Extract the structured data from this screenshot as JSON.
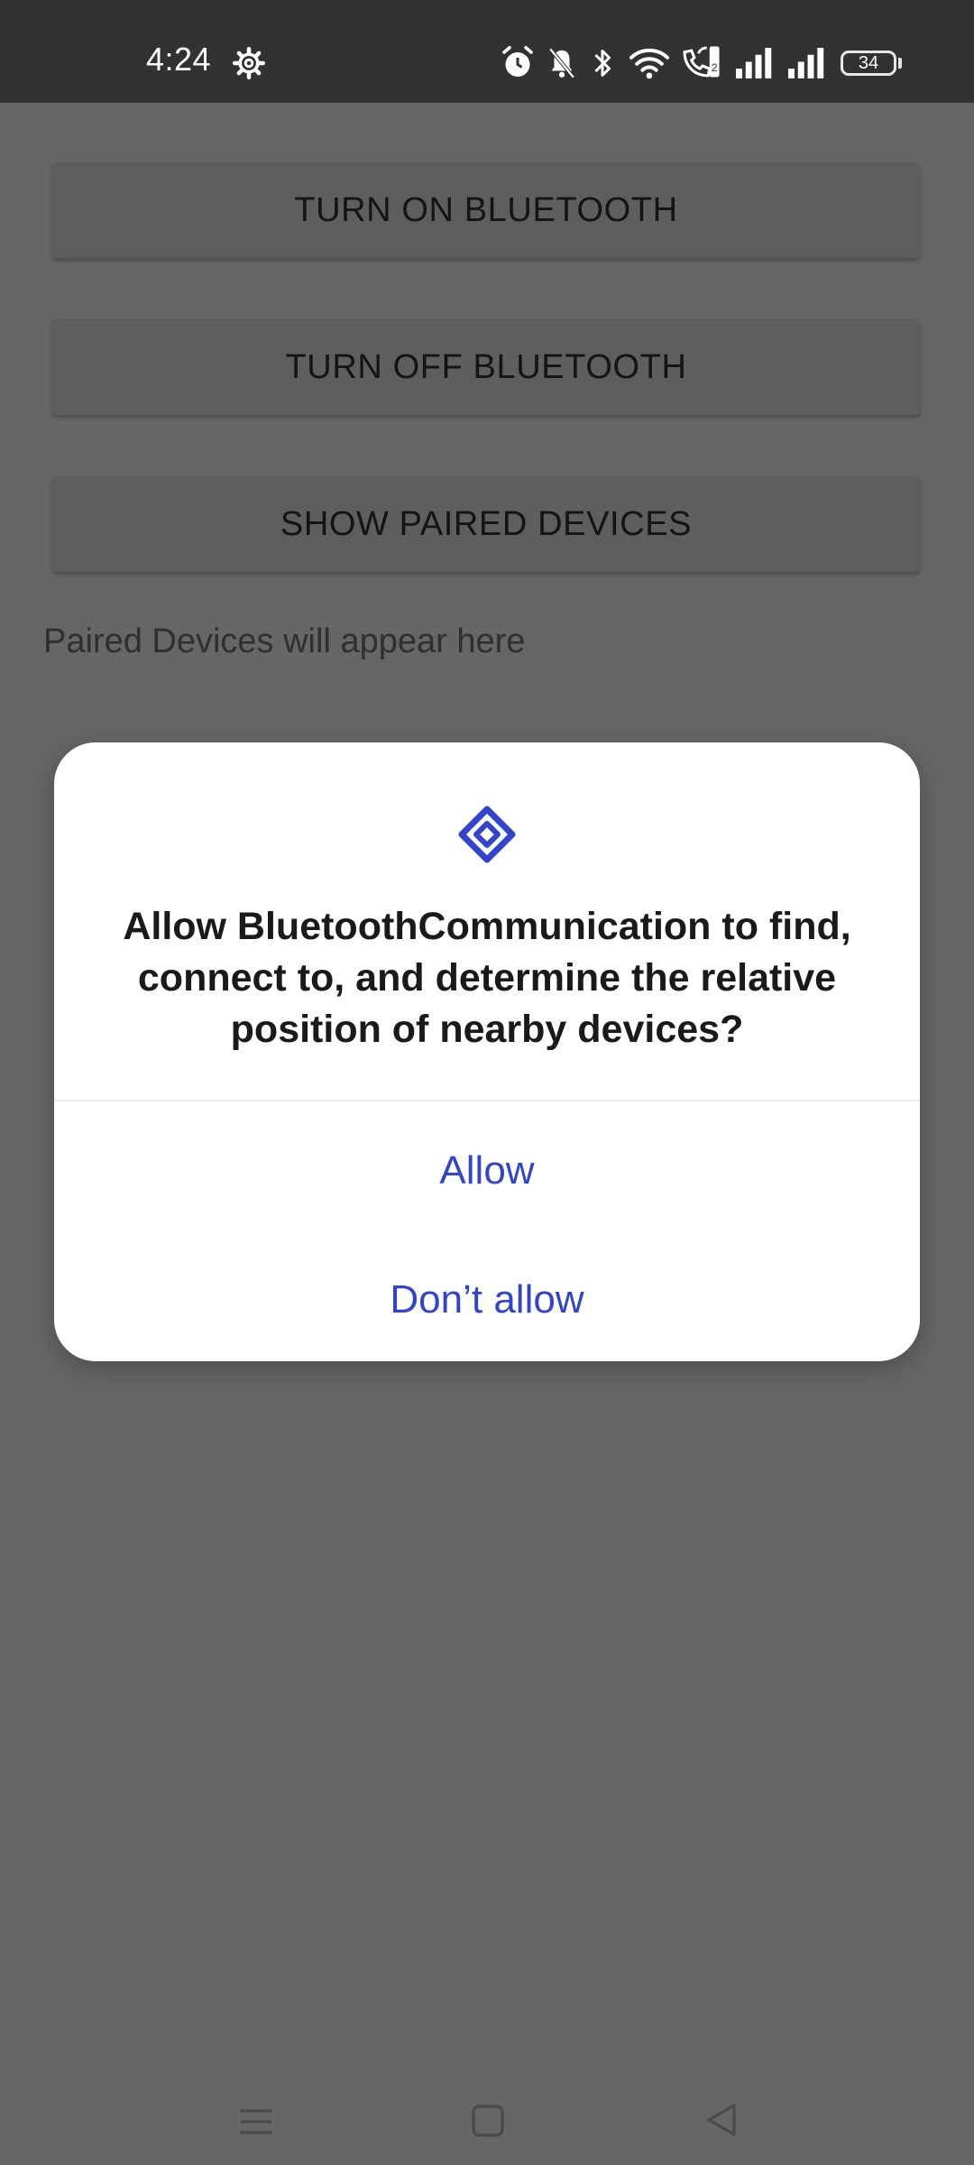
{
  "status_bar": {
    "time": "4:24",
    "battery_level": "34",
    "icons": [
      "settings-gear-icon",
      "alarm-icon",
      "mute-icon",
      "bluetooth-icon",
      "wifi-icon",
      "wifi-calling-icon",
      "signal-1-icon",
      "signal-2-icon",
      "battery-icon"
    ]
  },
  "app": {
    "buttons": {
      "turn_on": "TURN ON BLUETOOTH",
      "turn_off": "TURN OFF BLUETOOTH",
      "show_paired": "SHOW PAIRED DEVICES"
    },
    "paired_placeholder": "Paired Devices will appear here"
  },
  "dialog": {
    "icon": "nearby-devices-icon",
    "title": "Allow BluetoothCommunication to find, connect to, and determine the relative position of nearby devices?",
    "allow_label": "Allow",
    "deny_label": "Don’t allow"
  },
  "nav_bar": {
    "icons": [
      "menu-icon",
      "home-icon",
      "back-icon"
    ]
  },
  "colors": {
    "accent": "#3344cc",
    "scrim": "#666666",
    "status_bar": "#323232"
  }
}
